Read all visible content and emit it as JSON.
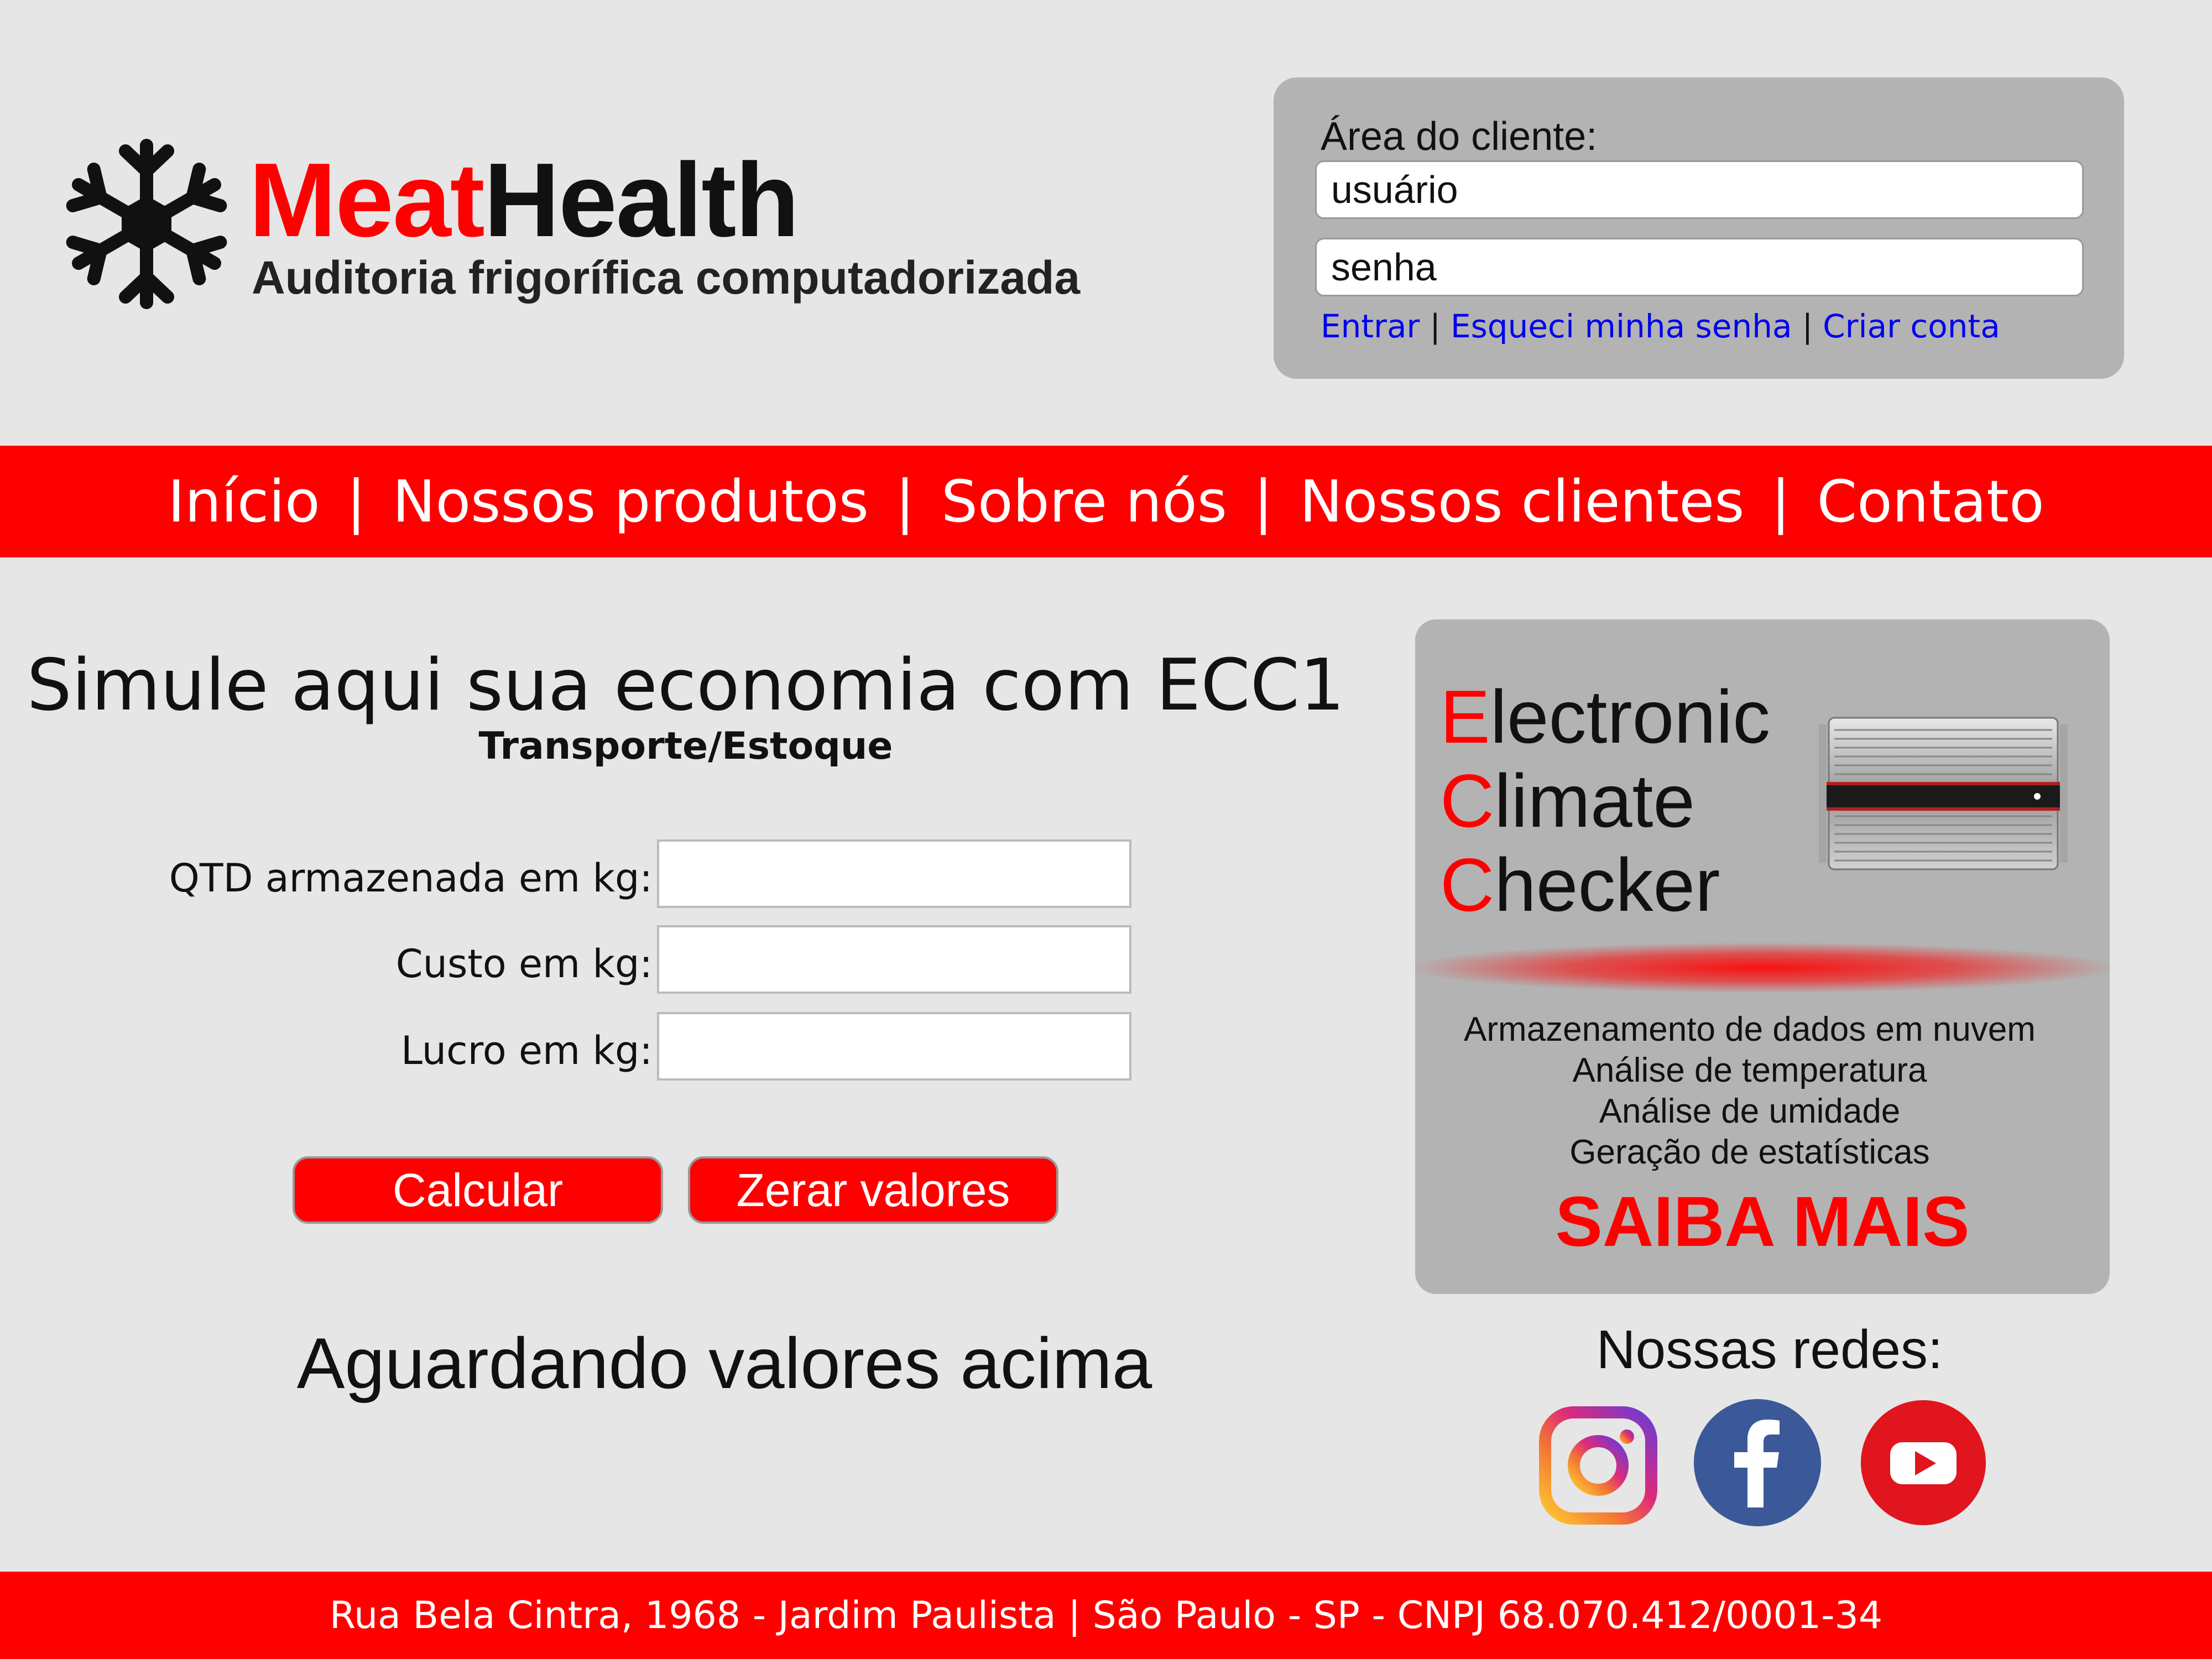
{
  "brand": {
    "name_part1": "Meat",
    "name_part2": "Health",
    "tagline": "Auditoria frigorífica computadorizada",
    "logo_icon": "snowflake-icon"
  },
  "login": {
    "title": "Área do cliente:",
    "username_placeholder": "usuário",
    "password_placeholder": "senha",
    "links": [
      {
        "label": "Entrar"
      },
      {
        "label": "Esqueci minha senha"
      },
      {
        "label": "Criar conta"
      }
    ],
    "separator": "|"
  },
  "nav": {
    "items": [
      {
        "label": "Início"
      },
      {
        "label": "Nossos produtos"
      },
      {
        "label": "Sobre nós"
      },
      {
        "label": "Nossos clientes"
      },
      {
        "label": "Contato"
      }
    ],
    "separator": "|"
  },
  "simulator": {
    "title": "Simule aqui sua economia com ECC1",
    "subtitle": "Transporte/Estoque",
    "fields": [
      {
        "label": "QTD armazenada em kg:",
        "value": ""
      },
      {
        "label": "Custo em kg:",
        "value": ""
      },
      {
        "label": "Lucro em kg:",
        "value": ""
      }
    ],
    "calc_label": "Calcular",
    "reset_label": "Zerar valores",
    "status": "Aguardando valores acima"
  },
  "product": {
    "lines": [
      {
        "initial": "E",
        "rest": "lectronic"
      },
      {
        "initial": "C",
        "rest": "limate"
      },
      {
        "initial": "C",
        "rest": "hecker"
      }
    ],
    "device_icon": "ecc-device-image",
    "features": [
      "Armazenamento de dados em nuvem",
      "Análise de temperatura",
      "Análise de umidade",
      "Geração de estatísticas"
    ],
    "cta": "SAIBA MAIS"
  },
  "social": {
    "title": "Nossas redes:",
    "icons": [
      "instagram-icon",
      "facebook-icon",
      "youtube-icon"
    ]
  },
  "colors": {
    "accent_red": "#ff0000",
    "background": "#e6e6e6",
    "panel_gray": "#b3b3b3",
    "link_blue": "#0000ee",
    "facebook_blue": "#3b5998",
    "youtube_red": "#e0151e"
  },
  "footer": {
    "text": "Rua Bela Cintra, 1968 - Jardim Paulista | São Paulo - SP - CNPJ 68.070.412/0001-34"
  }
}
